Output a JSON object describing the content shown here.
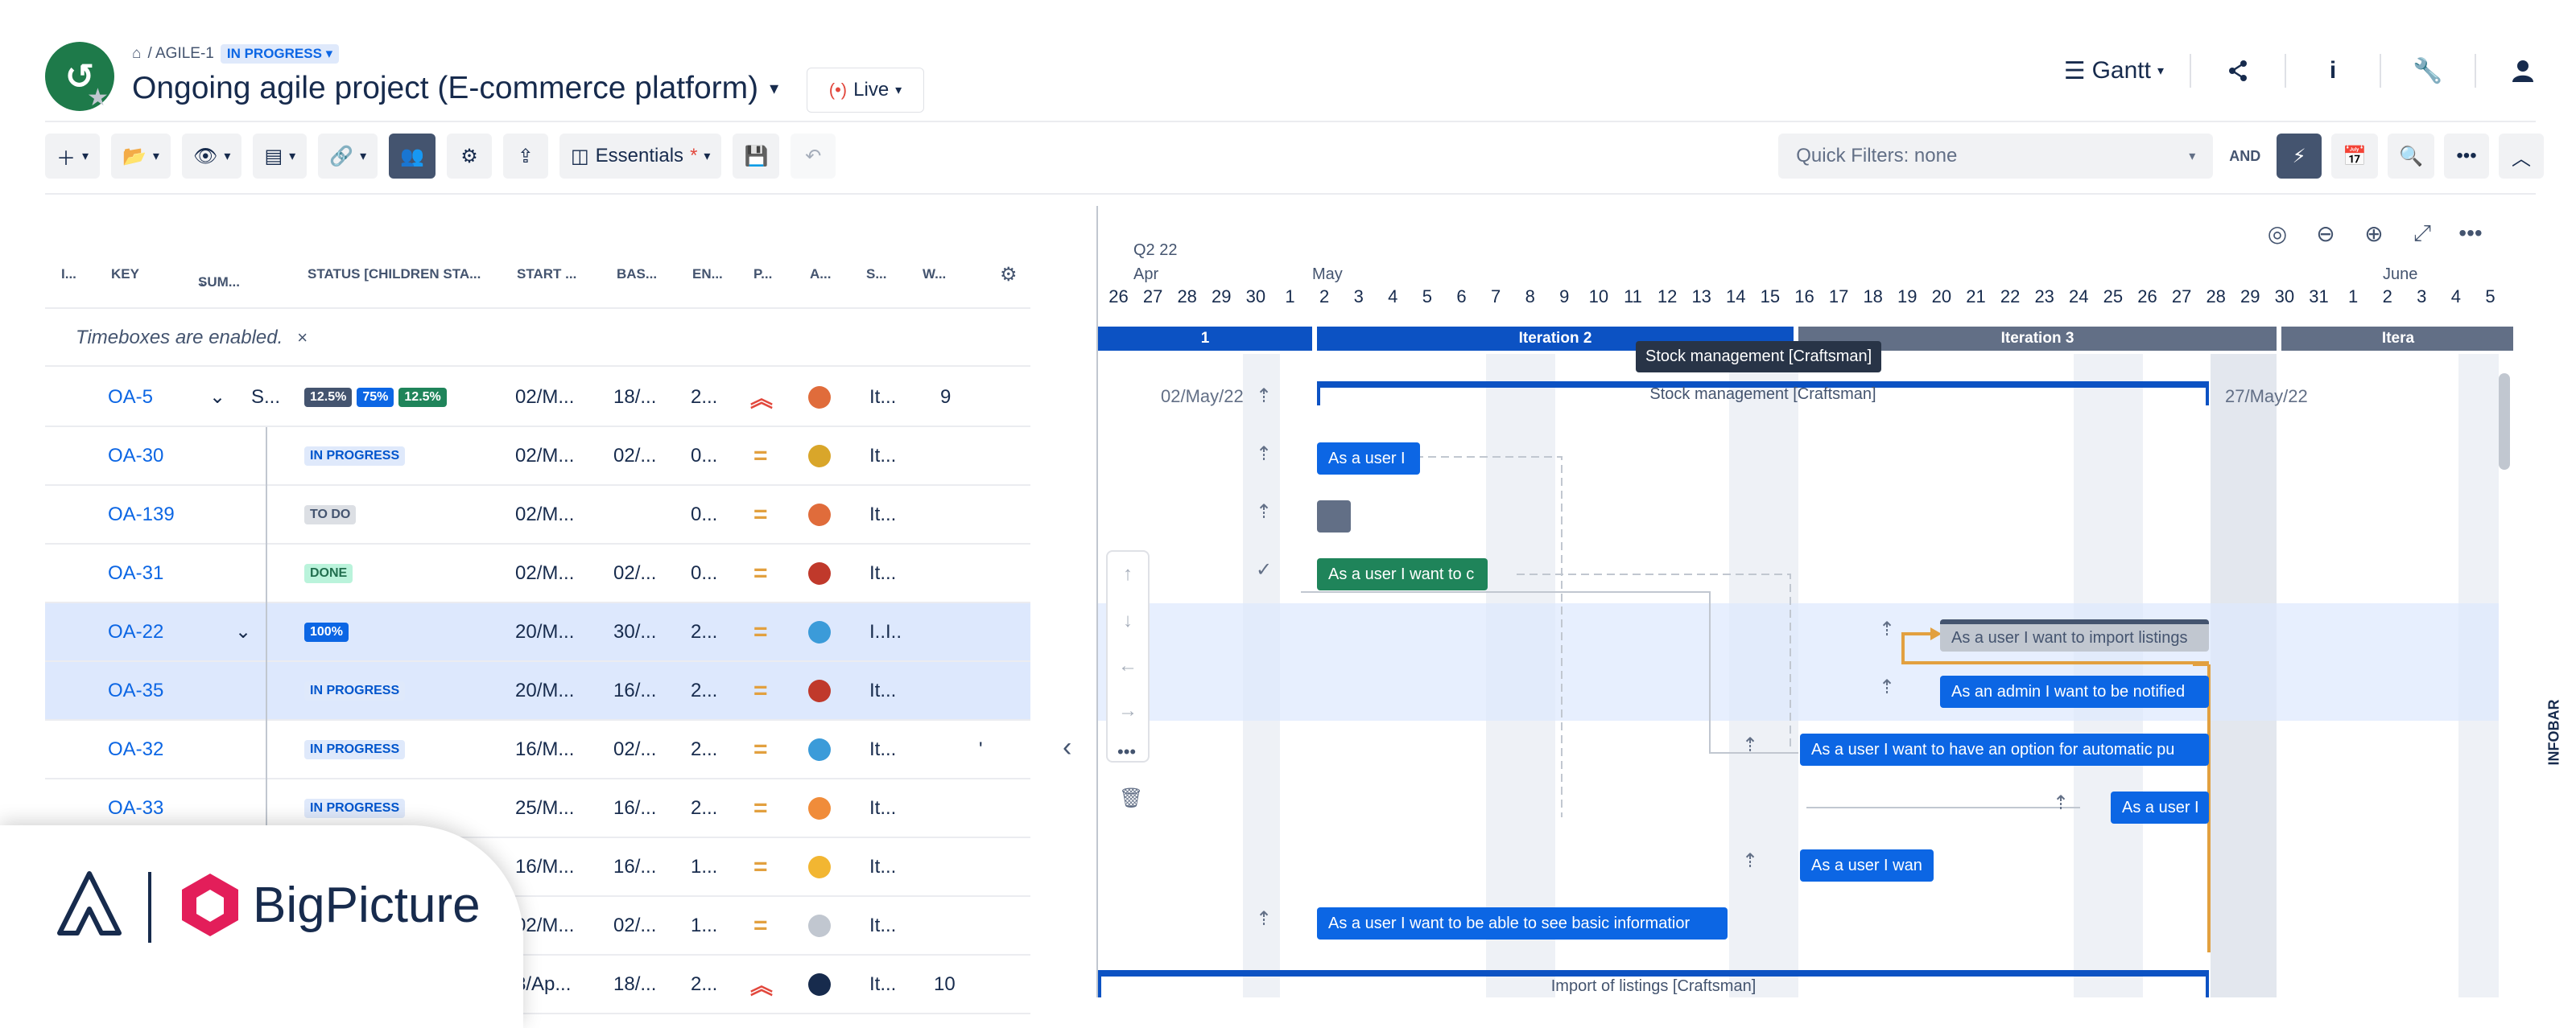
{
  "header": {
    "breadcrumb_home": "⌂",
    "breadcrumb_project": "/ AGILE-1",
    "breadcrumb_status": "IN PROGRESS",
    "title": "Ongoing agile project (E-commerce platform)",
    "live_label": "Live",
    "view_label": "Gantt"
  },
  "toolbar": {
    "view_preset": "Essentials",
    "quick_filters": "Quick Filters: none",
    "and_label": "AND"
  },
  "table": {
    "columns": [
      "I...",
      "KEY",
      "SUM...",
      "STATUS [CHILDREN STA...",
      "START ...",
      "BAS...",
      "EN...",
      "P...",
      "A...",
      "S...",
      "W..."
    ],
    "timebox_message": "Timeboxes are enabled.",
    "timebox_close": "×",
    "rows": [
      {
        "key": "OA-5",
        "sum": "S...",
        "start": "02/M...",
        "base": "18/...",
        "end": "2...",
        "sprint": "It...",
        "w": "9"
      },
      {
        "key": "OA-30",
        "status": "IN PROGRESS",
        "start": "02/M...",
        "base": "02/...",
        "end": "0...",
        "sprint": "It..."
      },
      {
        "key": "OA-139",
        "status": "TO DO",
        "start": "02/M...",
        "base": "",
        "end": "0...",
        "sprint": "It..."
      },
      {
        "key": "OA-31",
        "status": "DONE",
        "start": "02/M...",
        "base": "02/...",
        "end": "0...",
        "sprint": "It..."
      },
      {
        "key": "OA-22",
        "status": "100%",
        "start": "20/M...",
        "base": "30/...",
        "end": "2...",
        "sprint": "I..I.."
      },
      {
        "key": "OA-35",
        "status": "IN PROGRESS",
        "start": "20/M...",
        "base": "16/...",
        "end": "2...",
        "sprint": "It..."
      },
      {
        "key": "OA-32",
        "status": "IN PROGRESS",
        "start": "16/M...",
        "base": "02/...",
        "end": "2...",
        "sprint": "It...",
        "w": "'"
      },
      {
        "key": "OA-33",
        "status": "IN PROGRESS",
        "start": "25/M...",
        "base": "16/...",
        "end": "2...",
        "sprint": "It..."
      },
      {
        "key": "",
        "status": "",
        "start": "16/M...",
        "base": "16/...",
        "end": "1...",
        "sprint": "It..."
      },
      {
        "key": "",
        "status": "",
        "start": "02/M...",
        "base": "02/...",
        "end": "1...",
        "sprint": "It..."
      },
      {
        "key": "",
        "status": "",
        "start": "8/Ap...",
        "base": "18/...",
        "end": "2...",
        "sprint": "It...",
        "w": "10"
      }
    ],
    "oa5_badges": [
      "12.5%",
      "75%",
      "12.5%"
    ]
  },
  "gantt": {
    "quarter": "Q2 22",
    "months": [
      "Apr",
      "May",
      "June"
    ],
    "days": [
      "26",
      "27",
      "28",
      "29",
      "30",
      "1",
      "2",
      "3",
      "4",
      "5",
      "6",
      "7",
      "8",
      "9",
      "10",
      "11",
      "12",
      "13",
      "14",
      "15",
      "16",
      "17",
      "18",
      "19",
      "20",
      "21",
      "22",
      "23",
      "24",
      "25",
      "26",
      "27",
      "28",
      "29",
      "30",
      "31",
      "1",
      "2",
      "3",
      "4",
      "5"
    ],
    "iterations": [
      "1",
      "Iteration 2",
      "Iteration 3",
      "Itera"
    ],
    "tooltip": "Stock management [Craftsman]",
    "summary_label": "Stock management [Craftsman]",
    "summary_start": "02/May/22",
    "summary_end": "27/May/22",
    "bars": [
      "As a user I",
      "",
      "As a user I want to c",
      "As a user I want to import listings",
      "As an admin I want to be notified",
      "As a user I want to have an option for automatic pu",
      "As a user I",
      "As a user I wan",
      "As a user I want to be able to see basic informatior"
    ],
    "bottom_summary": "Import of listings [Craftsman]",
    "infobar": "INFOBAR"
  },
  "branding": {
    "logo_text": "BigPicture"
  }
}
